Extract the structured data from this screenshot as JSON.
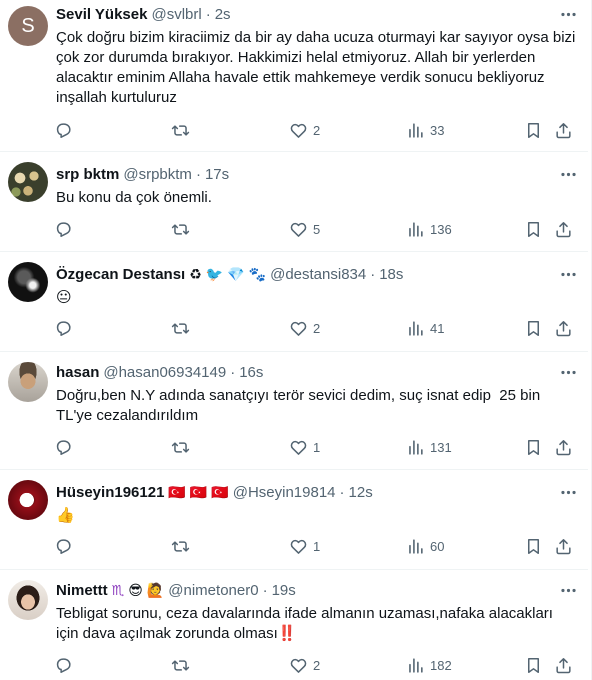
{
  "tweets": [
    {
      "name": "Sevil Yüksek",
      "name_emojis": [],
      "handle": "@svlbrl",
      "time": "2s",
      "text": "Çok doğru bizim kiraciimiz da bir ay daha ucuza oturmayi kar sayıyor oysa bizi çok zor durumda bırakıyor. Hakkimizi helal etmiyoruz. Allah bir yerlerden alacaktır eminim Allaha havale ettik mahkemeye verdik sonucu bekliyoruz inşallah kurtuluruz",
      "avatar": {
        "type": "letter",
        "letter": "S",
        "color": "#8b6f63"
      },
      "replies": "",
      "retweets": "",
      "likes": "2",
      "views": "33"
    },
    {
      "name": "srp bktm",
      "name_emojis": [],
      "handle": "@srpbktm",
      "time": "17s",
      "text": "Bu konu da çok önemli.",
      "avatar": {
        "type": "flowers"
      },
      "replies": "",
      "retweets": "",
      "likes": "5",
      "views": "136"
    },
    {
      "name": "Özgecan Destansı",
      "name_emojis": [
        "♻",
        "🐦",
        "💎",
        "🐾"
      ],
      "handle": "@destansi834",
      "time": "18s",
      "text": "😐",
      "avatar": {
        "type": "dark"
      },
      "replies": "",
      "retweets": "",
      "likes": "2",
      "views": "41"
    },
    {
      "name": "hasan",
      "name_emojis": [],
      "handle": "@hasan06934149",
      "time": "16s",
      "text": "Doğru,ben N.Y adında sanatçıyı terör sevici dedim, suç isnat edip  25 bin TL'ye cezalandırıldım",
      "avatar": {
        "type": "person"
      },
      "replies": "",
      "retweets": "",
      "likes": "1",
      "views": "131"
    },
    {
      "name": "Hüseyin196121",
      "name_emojis": [
        "🇹🇷",
        "🇹🇷",
        "🇹🇷"
      ],
      "handle": "@Hseyin19814",
      "time": "12s",
      "text": "👍",
      "avatar": {
        "type": "crescent"
      },
      "replies": "",
      "retweets": "",
      "likes": "1",
      "views": "60"
    },
    {
      "name": "Nimettt",
      "name_emojis": [
        "♏",
        "😎",
        "🙋"
      ],
      "handle": "@nimetoner0",
      "time": "19s",
      "text": "Tebligat sorunu, ceza davalarında ifade almanın uzaması,nafaka alacakları için dava açılmak zorunda olması‼️",
      "avatar": {
        "type": "woman"
      },
      "replies": "",
      "retweets": "",
      "likes": "2",
      "views": "182"
    }
  ],
  "colors": {
    "text_primary": "#0f1419",
    "text_secondary": "#536471",
    "divider": "#eff3f4"
  },
  "icons": [
    "more-icon",
    "reply-icon",
    "retweet-icon",
    "like-icon",
    "views-icon",
    "bookmark-icon",
    "share-icon"
  ]
}
